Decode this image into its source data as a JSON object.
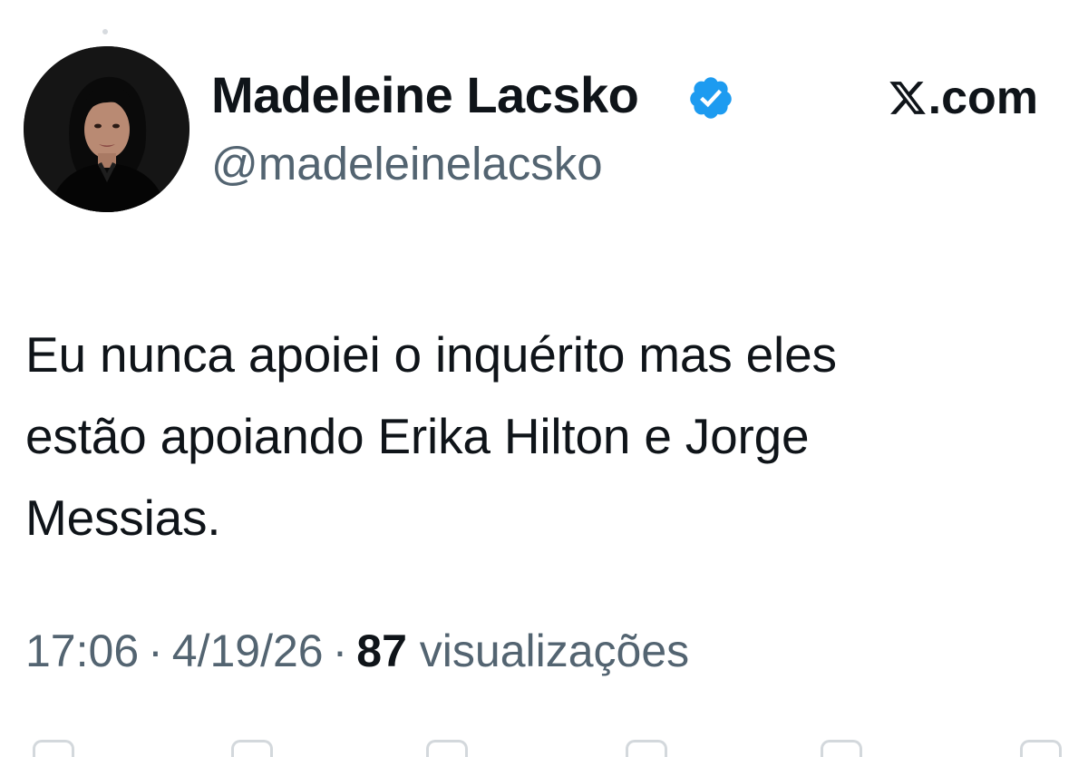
{
  "author": {
    "display_name": "Madeleine Lacsko",
    "handle": "@madeleinelacsko",
    "avatar_icon": "profile-photo",
    "verified_icon": "verified-badge-icon",
    "verified_color": "#1d9bf0"
  },
  "brand": {
    "logo_icon": "x-logo-icon",
    "label": ".com"
  },
  "tweet": {
    "text": "Eu nunca apoiei o inquérito mas eles\nestão apoiando Erika Hilton e Jorge\nMessias."
  },
  "meta": {
    "time": "17:06",
    "separator": "·",
    "date": "4/19/26",
    "views_count": "87",
    "views_label": "visualizações"
  },
  "colors": {
    "text": "#0f1419",
    "secondary": "#536471",
    "background": "#ffffff"
  }
}
